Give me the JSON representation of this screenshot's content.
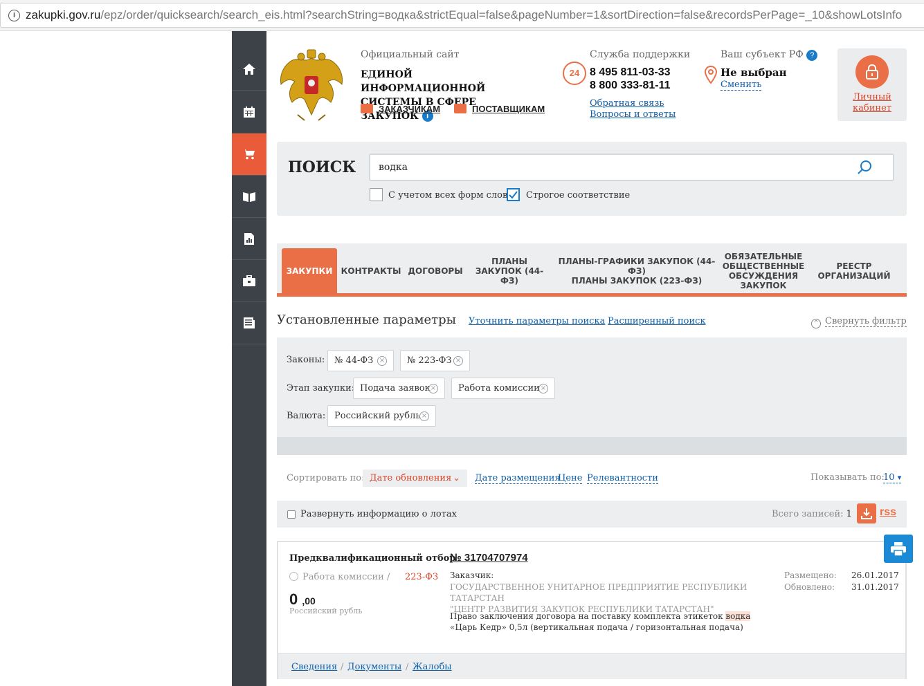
{
  "address_bar": {
    "host": "zakupki.gov.ru",
    "path": "/epz/order/quicksearch/search_eis.html?searchString=водка&strictEqual=false&pageNumber=1&sortDirection=false&recordsPerPage=_10&showLotsInfo"
  },
  "sidebar": {
    "items": [
      {
        "icon": "home-icon",
        "active": false
      },
      {
        "icon": "calendar-icon",
        "active": false
      },
      {
        "icon": "cart-icon",
        "active": true
      },
      {
        "icon": "book-icon",
        "active": false
      },
      {
        "icon": "report-icon",
        "active": false
      },
      {
        "icon": "briefcase-icon",
        "active": false
      },
      {
        "icon": "news-icon",
        "active": false
      }
    ]
  },
  "header": {
    "subtitle": "Официальный сайт",
    "title_line1": "ЕДИНОЙ ИНФОРМАЦИОННОЙ",
    "title_line2": "СИСТЕМЫ В СФЕРЕ ЗАКУПОК",
    "customers_label": "ЗАКАЗЧИКАМ",
    "suppliers_label": "ПОСТАВЩИКАМ",
    "support_title": "Служба поддержки",
    "support_badge": "24",
    "phone1": "8 495 811-03-33",
    "phone2": "8 800 333-81-11",
    "feedback_link": "Обратная связь",
    "faq_link": "Вопросы и ответы",
    "region_title": "Ваш субъект РФ",
    "region_value": "Не выбран",
    "region_change": "Сменить",
    "cabinet_line1": "Личный",
    "cabinet_line2": "кабинет"
  },
  "search": {
    "title": "ПОИСК",
    "value": "водка",
    "all_word_forms_label": "С учетом всех форм слов",
    "all_word_forms_checked": false,
    "strict_label": "Строгое соответствие",
    "strict_checked": true
  },
  "tabs": [
    {
      "line1": "ЗАКУПКИ",
      "line2": "",
      "line3": "",
      "line4": ""
    },
    {
      "line1": "КОНТРАКТЫ",
      "line2": "",
      "line3": "",
      "line4": ""
    },
    {
      "line1": "ДОГОВОРЫ",
      "line2": "",
      "line3": "",
      "line4": ""
    },
    {
      "line1": "ПЛАНЫ",
      "line2": "ЗАКУПОК (44-ФЗ)",
      "line3": "",
      "line4": ""
    },
    {
      "line1": "ПЛАНЫ-ГРАФИКИ ЗАКУПОК (44-ФЗ)",
      "line2": "ПЛАНЫ ЗАКУПОК (223-ФЗ)",
      "line3": "",
      "line4": ""
    },
    {
      "line1": "ОБЯЗАТЕЛЬНЫЕ",
      "line2": "ОБЩЕСТВЕННЫЕ",
      "line3": "ОБСУЖДЕНИЯ",
      "line4": "ЗАКУПОК"
    },
    {
      "line1": "РЕЕСТР",
      "line2": "ОРГАНИЗАЦИЙ",
      "line3": "",
      "line4": ""
    }
  ],
  "params": {
    "title": "Установленные параметры",
    "refine_link": "Уточнить параметры поиска",
    "advanced_link": "Расширенный поиск",
    "collapse_label": "Свернуть фильтр",
    "laws_label": "Законы:",
    "laws": [
      "№ 44-ФЗ",
      "№ 223-ФЗ"
    ],
    "stage_label": "Этап закупки:",
    "stages": [
      "Подача заявок",
      "Работа комиссии"
    ],
    "currency_label": "Валюта:",
    "currencies": [
      "Российский рубль"
    ]
  },
  "sort": {
    "label": "Сортировать по:",
    "active": "Дате обновления",
    "options": [
      "Дате размещения",
      "Цене",
      "Релевантности"
    ],
    "show_label": "Показывать по:",
    "show_value": "10"
  },
  "results_bar": {
    "expand_label": "Развернуть информацию о лотах",
    "total_label": "Всего записей:",
    "total_value": "1",
    "rss_label": "rss"
  },
  "result": {
    "type": "Предквалификационный отбор",
    "stage": "Работа комиссии /",
    "law": "223-ФЗ",
    "price_int": "0",
    "price_frac": ",00",
    "currency": "Российский рубль",
    "number": "№ 31704707974",
    "customer_label": "Заказчик:",
    "customer_line1": "ГОСУДАРСТВЕННОЕ УНИТАРНОЕ ПРЕДПРИЯТИЕ РЕСПУБЛИКИ ТАТАРСТАН",
    "customer_line2": "\"ЦЕНТР РАЗВИТИЯ ЗАКУПОК РЕСПУБЛИКИ ТАТАРСТАН\"",
    "desc_before": "Право заключения договора на поставку комплекта этикеток ",
    "desc_highlight": "водка",
    "desc_after": " «Царь Кедр» 0,5л (вертикальная подача / горизонтальная подача)",
    "posted_label": "Размещено:",
    "posted_value": "26.01.2017",
    "updated_label": "Обновлено:",
    "updated_value": "31.01.2017",
    "links": [
      "Сведения",
      "Документы",
      "Жалобы"
    ]
  },
  "colors": {
    "accent": "#ea6f47",
    "sidebar": "#3d4248",
    "link": "#0f5ea8",
    "panel": "#eceeef"
  }
}
